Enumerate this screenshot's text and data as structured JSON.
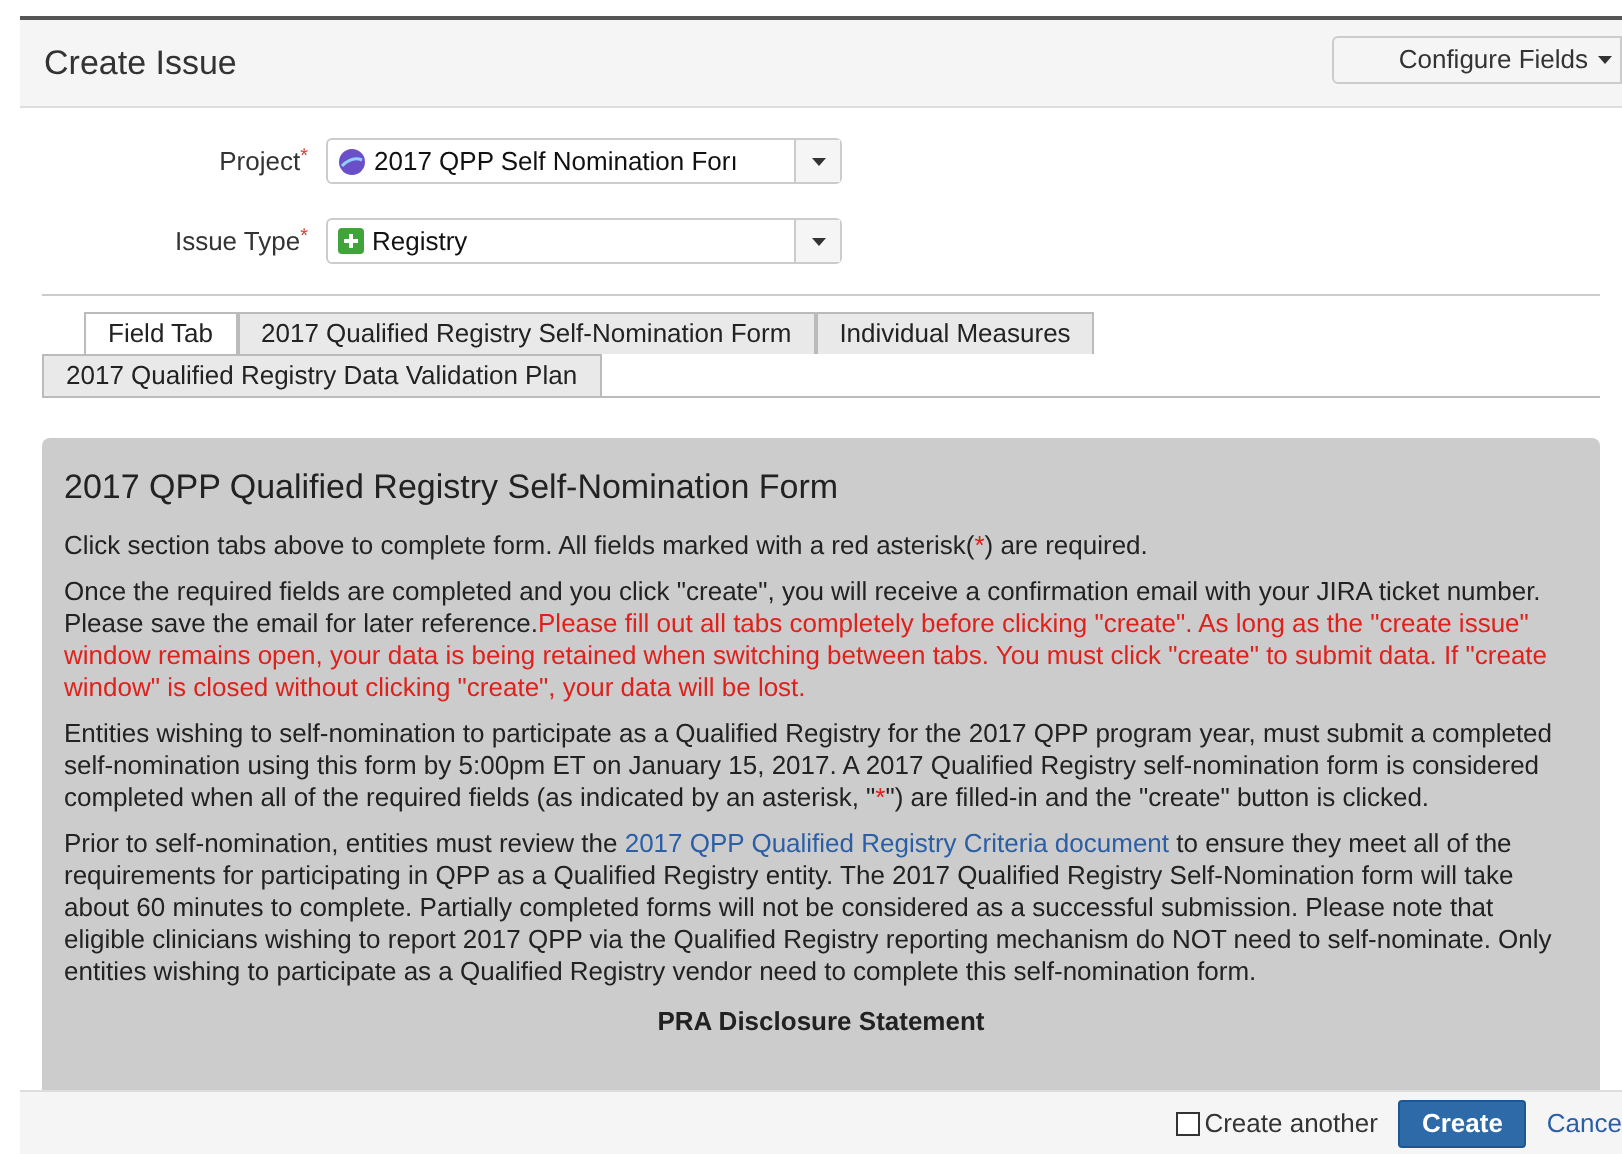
{
  "dialog": {
    "title": "Create Issue",
    "configure_button": "Configure Fields"
  },
  "fields": [
    {
      "label": "Project",
      "required": true,
      "value": "2017 QPP Self Nomination Forı",
      "kind": "project"
    },
    {
      "label": "Issue Type",
      "required": true,
      "value": "Registry",
      "kind": "registry"
    }
  ],
  "tabs": [
    {
      "label": "Field Tab",
      "selected": true
    },
    {
      "label": "2017 Qualified Registry Self-Nomination Form",
      "selected": false
    },
    {
      "label": "Individual Measures",
      "selected": false
    },
    {
      "label": "2017 Qualified Registry Data Validation Plan",
      "selected": false
    }
  ],
  "panel": {
    "heading": "2017 QPP Qualified Registry Self-Nomination Form",
    "paragraphs": [
      [
        {
          "kind": "text",
          "text": "Click section tabs above to complete form. All fields marked with a red asterisk("
        },
        {
          "kind": "warning",
          "text": "*"
        },
        {
          "kind": "text",
          "text": ") are required."
        }
      ],
      [
        {
          "kind": "text",
          "text": "Once the required fields are completed and you click \"create\", you will receive a confirmation email with your JIRA ticket number. Please save the email for later reference."
        },
        {
          "kind": "warning",
          "text": "Please fill out all tabs completely before clicking \"create\". As long as the \"create issue\" window remains open, your data is being retained when switching between tabs. You must click \"create\" to submit data. If \"create window\" is closed without clicking \"create\", your data will be lost."
        }
      ],
      [
        {
          "kind": "text",
          "text": "Entities wishing to self-nomination to participate as a Qualified Registry for the 2017 QPP program year, must submit a completed self-nomination using this form by 5:00pm ET on January 15, 2017. A 2017 Qualified Registry self-nomination form is considered completed when all of the required fields (as indicated by an asterisk, \""
        },
        {
          "kind": "warning",
          "text": "*"
        },
        {
          "kind": "text",
          "text": "\") are filled-in and the \"create\" button is clicked."
        }
      ],
      [
        {
          "kind": "text",
          "text": "Prior to self-nomination, entities must review the "
        },
        {
          "kind": "link",
          "text": "2017 QPP Qualified Registry Criteria document"
        },
        {
          "kind": "text",
          "text": " to ensure they meet all of the requirements for participating in QPP as a Qualified Registry entity. The 2017 Qualified Registry Self-Nomination form will take about 60 minutes to complete. Partially completed forms will not be considered as a successful submission. Please note that eligible clinicians wishing to report 2017 QPP via the Qualified Registry reporting mechanism do NOT need to self-nominate. Only entities wishing to participate as a Qualified Registry vendor need to complete this self-nomination form."
        }
      ]
    ],
    "subheading": "PRA Disclosure Statement"
  },
  "footer": {
    "create_another": {
      "label": "Create another",
      "checked": false
    },
    "create_button": "Create",
    "cancel_link": "Cance"
  }
}
